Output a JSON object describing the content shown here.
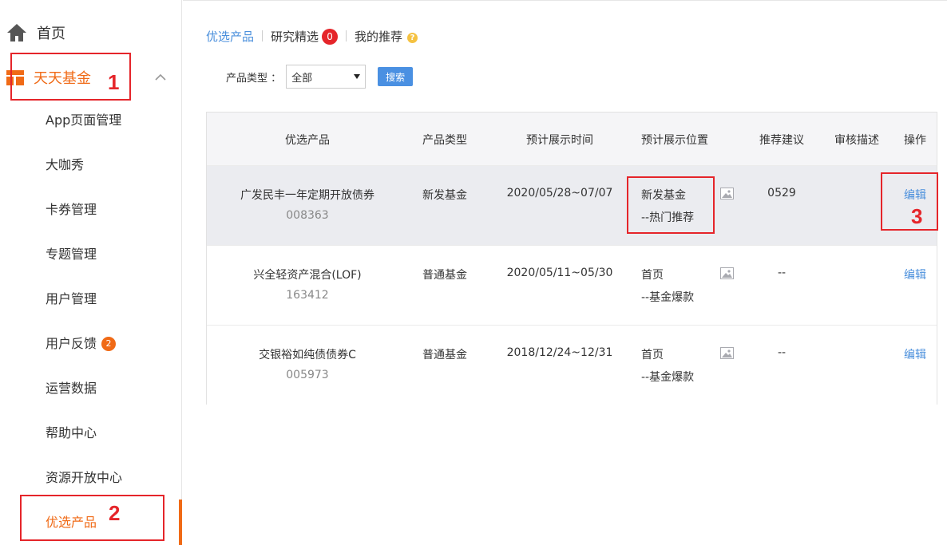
{
  "sidebar": {
    "home": "首页",
    "fund": "天天基金",
    "items": [
      "App页面管理",
      "大咖秀",
      "卡券管理",
      "专题管理",
      "用户管理",
      "用户反馈",
      "运营数据",
      "帮助中心",
      "资源开放中心",
      "优选产品"
    ],
    "feedback_badge": "2"
  },
  "annotations": [
    "1",
    "2",
    "3"
  ],
  "tabs": [
    {
      "label": "优选产品"
    },
    {
      "label": "研究精选",
      "badge": "0"
    },
    {
      "label": "我的推荐"
    }
  ],
  "filter": {
    "label": "产品类型 ：",
    "selected": "全部",
    "search_button": "搜索"
  },
  "table": {
    "headers": [
      "优选产品",
      "产品类型",
      "预计展示时间",
      "预计展示位置",
      "推荐建议",
      "审核描述",
      "操作"
    ],
    "rows": [
      {
        "name": "广发民丰一年定期开放债券",
        "code": "008363",
        "type": "新发基金",
        "time": "2020/05/28~07/07",
        "pos1": "新发基金",
        "pos2": "--热门推荐",
        "advice": "0529",
        "desc": "",
        "action": "编辑"
      },
      {
        "name": "兴全轻资产混合(LOF)",
        "code": "163412",
        "type": "普通基金",
        "time": "2020/05/11~05/30",
        "pos1": "首页",
        "pos2": "--基金爆款",
        "advice": "--",
        "desc": "",
        "action": "编辑"
      },
      {
        "name": "交银裕如纯债债券C",
        "code": "005973",
        "type": "普通基金",
        "time": "2018/12/24~12/31",
        "pos1": "首页",
        "pos2": "--基金爆款",
        "advice": "--",
        "desc": "",
        "action": "编辑"
      }
    ]
  },
  "colors": {
    "accent_orange": "#f06a16",
    "link_blue": "#4a8fdc",
    "annotation_red": "#e5252a"
  }
}
